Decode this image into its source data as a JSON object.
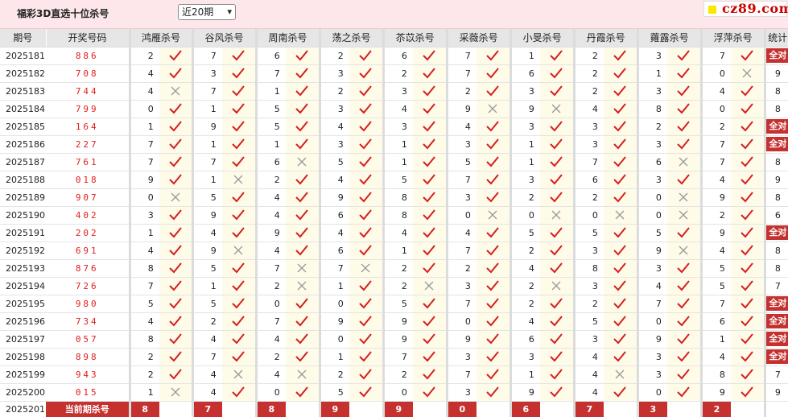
{
  "header": {
    "title": "福彩3D直选十位杀号",
    "period_select": "近20期",
    "logo": "cz89.com"
  },
  "columns": {
    "period": "期号",
    "draw": "开奖号码",
    "experts": [
      "鸿雁杀号",
      "谷风杀号",
      "周南杀号",
      "荡之杀号",
      "苶苡杀号",
      "采薇杀号",
      "小旻杀号",
      "丹霞杀号",
      "蕹露杀号",
      "浮萍杀号"
    ],
    "stat": "统计"
  },
  "rows": [
    {
      "period": "2025181",
      "draw": "886",
      "kills": [
        "2",
        "7",
        "6",
        "2",
        "6",
        "7",
        "1",
        "2",
        "3",
        "7"
      ],
      "results": [
        1,
        1,
        1,
        1,
        1,
        1,
        1,
        1,
        1,
        1
      ],
      "stat": "全对"
    },
    {
      "period": "2025182",
      "draw": "708",
      "kills": [
        "4",
        "3",
        "7",
        "3",
        "2",
        "7",
        "6",
        "2",
        "1",
        "0"
      ],
      "results": [
        1,
        1,
        1,
        1,
        1,
        1,
        1,
        1,
        1,
        0
      ],
      "stat": "9"
    },
    {
      "period": "2025183",
      "draw": "744",
      "kills": [
        "4",
        "7",
        "1",
        "2",
        "3",
        "2",
        "3",
        "2",
        "3",
        "4"
      ],
      "results": [
        0,
        1,
        1,
        1,
        1,
        1,
        1,
        1,
        1,
        1
      ],
      "stat": "8"
    },
    {
      "period": "2025184",
      "draw": "799",
      "kills": [
        "0",
        "1",
        "5",
        "3",
        "4",
        "9",
        "9",
        "4",
        "8",
        "0"
      ],
      "results": [
        1,
        1,
        1,
        1,
        1,
        0,
        0,
        1,
        1,
        1
      ],
      "stat": "8"
    },
    {
      "period": "2025185",
      "draw": "164",
      "kills": [
        "1",
        "9",
        "5",
        "4",
        "3",
        "4",
        "3",
        "3",
        "2",
        "2"
      ],
      "results": [
        1,
        1,
        1,
        1,
        1,
        1,
        1,
        1,
        1,
        1
      ],
      "stat": "全对"
    },
    {
      "period": "2025186",
      "draw": "227",
      "kills": [
        "7",
        "1",
        "1",
        "3",
        "1",
        "3",
        "1",
        "3",
        "3",
        "7"
      ],
      "results": [
        1,
        1,
        1,
        1,
        1,
        1,
        1,
        1,
        1,
        1
      ],
      "stat": "全对"
    },
    {
      "period": "2025187",
      "draw": "761",
      "kills": [
        "7",
        "7",
        "6",
        "5",
        "1",
        "5",
        "1",
        "7",
        "6",
        "7"
      ],
      "results": [
        1,
        1,
        0,
        1,
        1,
        1,
        1,
        1,
        0,
        1
      ],
      "stat": "8"
    },
    {
      "period": "2025188",
      "draw": "018",
      "kills": [
        "9",
        "1",
        "2",
        "4",
        "5",
        "7",
        "3",
        "6",
        "3",
        "4"
      ],
      "results": [
        1,
        0,
        1,
        1,
        1,
        1,
        1,
        1,
        1,
        1
      ],
      "stat": "9"
    },
    {
      "period": "2025189",
      "draw": "907",
      "kills": [
        "0",
        "5",
        "4",
        "9",
        "8",
        "3",
        "2",
        "2",
        "0",
        "9"
      ],
      "results": [
        0,
        1,
        1,
        1,
        1,
        1,
        1,
        1,
        0,
        1
      ],
      "stat": "8"
    },
    {
      "period": "2025190",
      "draw": "402",
      "kills": [
        "3",
        "9",
        "4",
        "6",
        "8",
        "0",
        "0",
        "0",
        "0",
        "2"
      ],
      "results": [
        1,
        1,
        1,
        1,
        1,
        0,
        0,
        0,
        0,
        1
      ],
      "stat": "6"
    },
    {
      "period": "2025191",
      "draw": "202",
      "kills": [
        "1",
        "4",
        "9",
        "4",
        "4",
        "4",
        "5",
        "5",
        "5",
        "9"
      ],
      "results": [
        1,
        1,
        1,
        1,
        1,
        1,
        1,
        1,
        1,
        1
      ],
      "stat": "全对"
    },
    {
      "period": "2025192",
      "draw": "691",
      "kills": [
        "4",
        "9",
        "4",
        "6",
        "1",
        "7",
        "2",
        "3",
        "9",
        "4"
      ],
      "results": [
        1,
        0,
        1,
        1,
        1,
        1,
        1,
        1,
        0,
        1
      ],
      "stat": "8"
    },
    {
      "period": "2025193",
      "draw": "876",
      "kills": [
        "8",
        "5",
        "7",
        "7",
        "2",
        "2",
        "4",
        "8",
        "3",
        "5"
      ],
      "results": [
        1,
        1,
        0,
        0,
        1,
        1,
        1,
        1,
        1,
        1
      ],
      "stat": "8"
    },
    {
      "period": "2025194",
      "draw": "726",
      "kills": [
        "7",
        "1",
        "2",
        "1",
        "2",
        "3",
        "2",
        "3",
        "4",
        "5"
      ],
      "results": [
        1,
        1,
        0,
        1,
        0,
        1,
        0,
        1,
        1,
        1
      ],
      "stat": "7"
    },
    {
      "period": "2025195",
      "draw": "980",
      "kills": [
        "5",
        "5",
        "0",
        "0",
        "5",
        "7",
        "2",
        "2",
        "7",
        "7"
      ],
      "results": [
        1,
        1,
        1,
        1,
        1,
        1,
        1,
        1,
        1,
        1
      ],
      "stat": "全对"
    },
    {
      "period": "2025196",
      "draw": "734",
      "kills": [
        "4",
        "2",
        "7",
        "9",
        "9",
        "0",
        "4",
        "5",
        "0",
        "6"
      ],
      "results": [
        1,
        1,
        1,
        1,
        1,
        1,
        1,
        1,
        1,
        1
      ],
      "stat": "全对"
    },
    {
      "period": "2025197",
      "draw": "057",
      "kills": [
        "8",
        "4",
        "4",
        "0",
        "9",
        "9",
        "6",
        "3",
        "9",
        "1"
      ],
      "results": [
        1,
        1,
        1,
        1,
        1,
        1,
        1,
        1,
        1,
        1
      ],
      "stat": "全对"
    },
    {
      "period": "2025198",
      "draw": "898",
      "kills": [
        "2",
        "7",
        "2",
        "1",
        "7",
        "3",
        "3",
        "4",
        "3",
        "4"
      ],
      "results": [
        1,
        1,
        1,
        1,
        1,
        1,
        1,
        1,
        1,
        1
      ],
      "stat": "全对"
    },
    {
      "period": "2025199",
      "draw": "943",
      "kills": [
        "2",
        "4",
        "4",
        "2",
        "2",
        "7",
        "1",
        "4",
        "3",
        "8"
      ],
      "results": [
        1,
        0,
        0,
        1,
        1,
        1,
        1,
        0,
        1,
        1
      ],
      "stat": "7"
    },
    {
      "period": "2025200",
      "draw": "015",
      "kills": [
        "1",
        "4",
        "0",
        "5",
        "0",
        "3",
        "9",
        "4",
        "0",
        "9"
      ],
      "results": [
        0,
        1,
        1,
        1,
        1,
        1,
        1,
        1,
        1,
        1
      ],
      "stat": "9"
    }
  ],
  "current": {
    "period": "2025201",
    "label": "当前期杀号",
    "kills": [
      "8",
      "7",
      "8",
      "9",
      "9",
      "0",
      "6",
      "7",
      "3",
      "2"
    ]
  }
}
